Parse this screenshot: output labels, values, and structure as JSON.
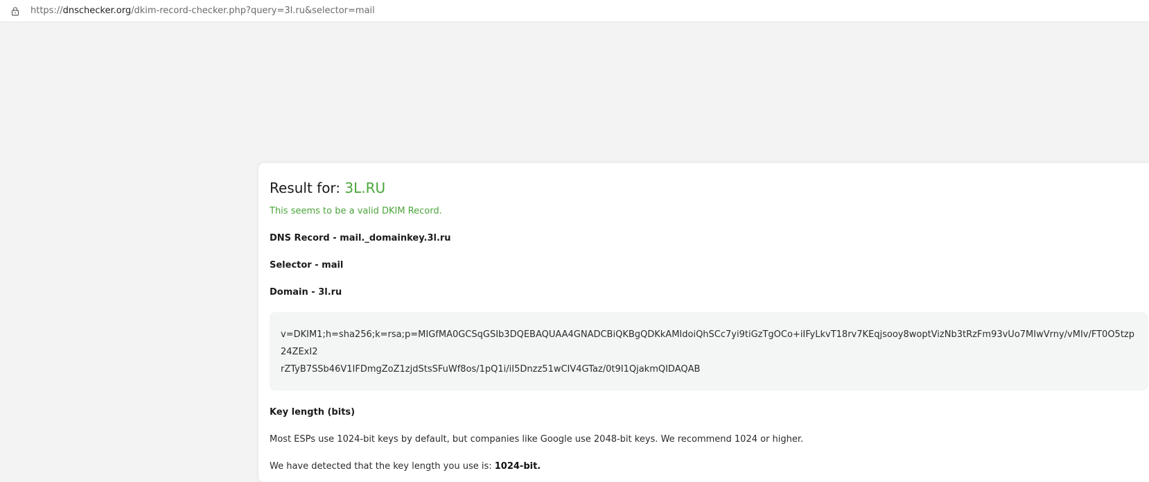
{
  "browser": {
    "url_prefix": "https://",
    "url_host": "dnschecker.org",
    "url_path": "/dkim-record-checker.php?query=3l.ru&selector=mail"
  },
  "result": {
    "title_label": "Result for:",
    "domain": "3L.RU",
    "valid_message": "This seems to be a valid DKIM Record.",
    "dns_record": "DNS Record - mail._domainkey.3l.ru",
    "selector": "Selector - mail",
    "domain_line": "Domain - 3l.ru",
    "record_line1": "v=DKIM1;h=sha256;k=rsa;p=MIGfMA0GCSqGSIb3DQEBAQUAA4GNADCBiQKBgQDKkAMIdoiQhSCc7yi9tiGzTgOCo+iIFyLkvT18rv7KEqjsooy8woptVizNb3tRzFm93vUo7MIwVrny/vMIv/FT0O5tzp24ZExI2",
    "record_line2": "rZTyB7SSb46V1IFDmgZoZ1zjdStsSFuWf8os/1pQ1i/iI5Dnzz51wCIV4GTaz/0t9I1QjakmQIDAQAB",
    "key_length_title": "Key length (bits)",
    "key_length_desc": "Most ESPs use 1024-bit keys by default, but companies like Google use 2048-bit keys. We recommend 1024 or higher.",
    "detected_prefix": "We have detected that the key length you use is:",
    "detected_value": "1024-bit."
  },
  "colors": {
    "accent_green": "#4aa43a",
    "page_bg": "#f3f3f3"
  },
  "icons": {
    "address_lock": "lock-icon"
  }
}
